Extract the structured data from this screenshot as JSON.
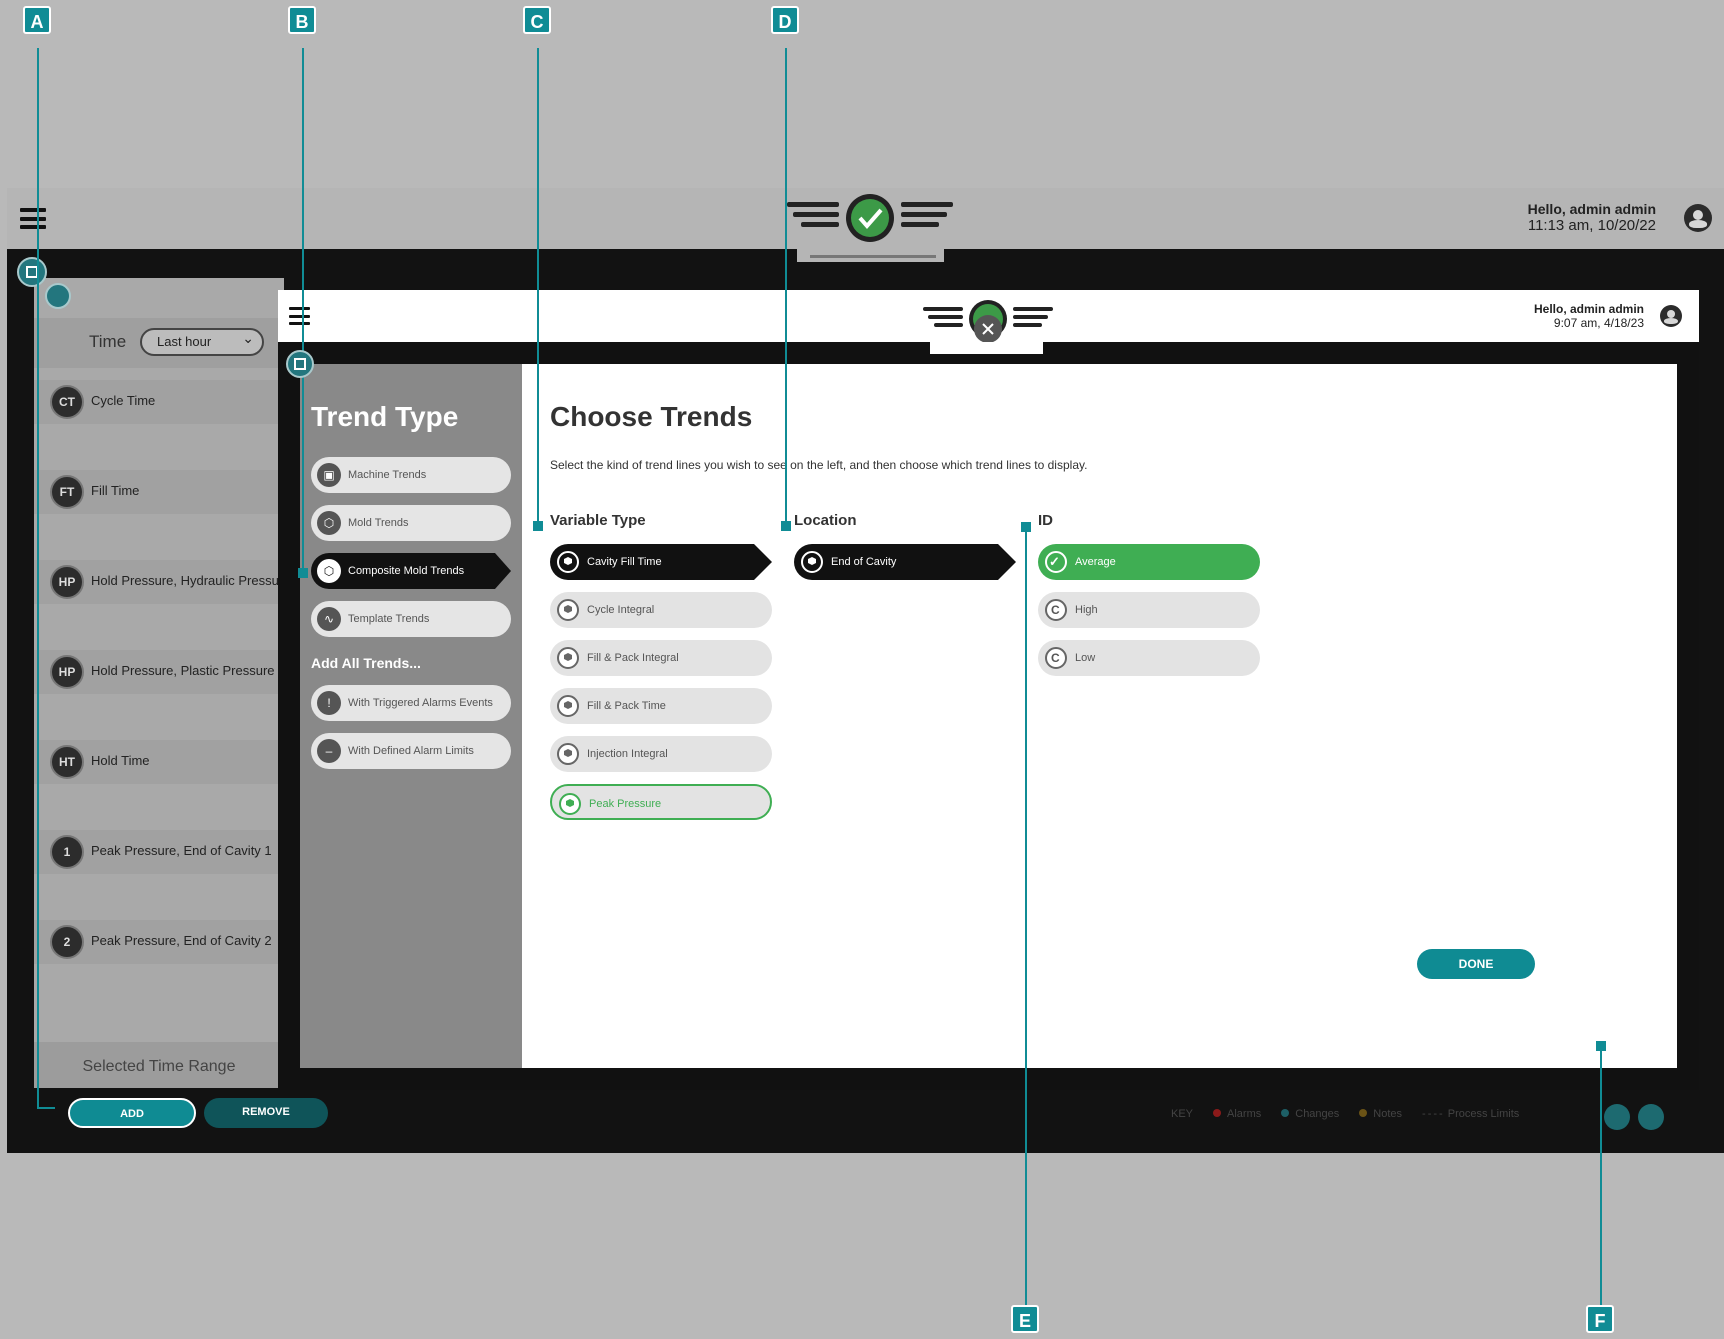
{
  "outer": {
    "greeting": "Hello, admin admin",
    "datetime": "11:13 am, 10/20/22",
    "time_label": "Time",
    "time_select": "Last hour",
    "trends": [
      {
        "badge": "CT",
        "name": "Cycle Time"
      },
      {
        "badge": "FT",
        "name": "Fill Time"
      },
      {
        "badge": "HP",
        "name": "Hold Pressure, Hydraulic Pressure"
      },
      {
        "badge": "HP",
        "name": "Hold Pressure, Plastic Pressure"
      },
      {
        "badge": "HT",
        "name": "Hold Time"
      },
      {
        "badge": "1",
        "name": "Peak Pressure, End of Cavity 1"
      },
      {
        "badge": "2",
        "name": "Peak Pressure, End of Cavity 2"
      }
    ],
    "selected_range": "Selected Time Range",
    "add_label": "ADD",
    "remove_label": "REMOVE",
    "legend": {
      "key": "KEY",
      "items": [
        {
          "label": "Alarms",
          "color": "#8b1a1a"
        },
        {
          "label": "Changes",
          "color": "#1d5f66"
        },
        {
          "label": "Notes",
          "color": "#6b5316"
        },
        {
          "label": "Process Limits",
          "color": ""
        }
      ]
    }
  },
  "inner": {
    "greeting": "Hello, admin admin",
    "datetime": "9:07 am, 4/18/23",
    "sidebar": {
      "title": "Trend Type",
      "items": [
        {
          "label": "Machine Trends",
          "icon": "machine-icon"
        },
        {
          "label": "Mold Trends",
          "icon": "mold-icon"
        },
        {
          "label": "Composite Mold Trends",
          "icon": "composite-mold-icon"
        },
        {
          "label": "Template Trends",
          "icon": "template-icon"
        }
      ],
      "add_all_title": "Add All Trends...",
      "add_all_items": [
        {
          "label": "With Triggered Alarms Events",
          "icon": "alert-icon"
        },
        {
          "label": "With Defined Alarm Limits",
          "icon": "limits-icon"
        }
      ]
    },
    "main": {
      "title": "Choose Trends",
      "description": "Select the kind of trend lines you wish to see on the left, and then choose which trend lines to display.",
      "variable_type": {
        "title": "Variable Type",
        "options": [
          "Cavity Fill Time",
          "Cycle Integral",
          "Fill & Pack Integral",
          "Fill & Pack Time",
          "Injection Integral",
          "Peak Pressure"
        ]
      },
      "location": {
        "title": "Location",
        "options": [
          "End of Cavity"
        ]
      },
      "id": {
        "title": "ID",
        "options": [
          "Average",
          "High",
          "Low"
        ]
      },
      "done_label": "DONE"
    }
  },
  "callouts": [
    "A",
    "B",
    "C",
    "D",
    "E",
    "F"
  ],
  "colors": {
    "accent": "#108c95",
    "selected_green": "#3fae53"
  }
}
